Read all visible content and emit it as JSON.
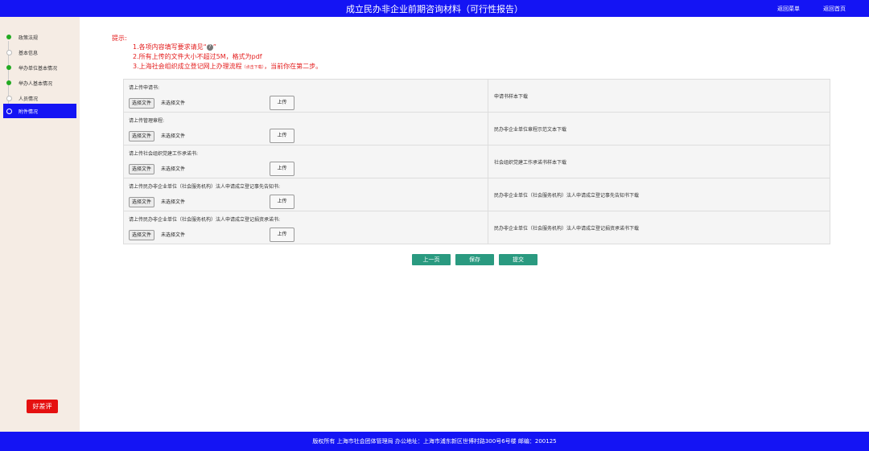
{
  "header": {
    "title": "成立民办非企业前期咨询材料（可行性报告）",
    "return_menu": "返回菜单",
    "return_home": "返回首页"
  },
  "sidebar": {
    "items": [
      {
        "label": "政策法规",
        "state": "done"
      },
      {
        "label": "基本信息",
        "state": "todo"
      },
      {
        "label": "举办单位基本情况",
        "state": "done"
      },
      {
        "label": "举办人基本情况",
        "state": "done"
      },
      {
        "label": "人员情况",
        "state": "todo"
      },
      {
        "label": "附件情况",
        "state": "current"
      }
    ],
    "review_button": "好差评"
  },
  "tips": {
    "heading": "提示:",
    "line1": "1.各项内容填写要求请见“",
    "line1_end": "”",
    "help_icon": "?",
    "line2": "2.所有上传的文件大小不超过5M，格式为pdf",
    "line3_a": "3.上海社会组织成立登记网上办理流程",
    "line3_small": "（点击下载）",
    "line3_b": "，当前你在第二步。"
  },
  "uploads": [
    {
      "label": "请上传申请书:",
      "choose": "选择文件",
      "nofile": "未选择文件",
      "upload": "上传",
      "download": "申请书样本下载"
    },
    {
      "label": "请上传管理章程:",
      "choose": "选择文件",
      "nofile": "未选择文件",
      "upload": "上传",
      "download": "民办非企业单位章程示范文本下载"
    },
    {
      "label": "请上传社会组织党建工作承诺书:",
      "choose": "选择文件",
      "nofile": "未选择文件",
      "upload": "上传",
      "download": "社会组织党建工作承诺书样本下载"
    },
    {
      "label": "请上传民办非企业单位（社会服务机构）法人申请成立登记事先告知书:",
      "choose": "选择文件",
      "nofile": "未选择文件",
      "upload": "上传",
      "download": "民办非企业单位（社会服务机构）法人申请成立登记事先告知书下载"
    },
    {
      "label": "请上传民办非企业单位（社会服务机构）法人申请成立登记捐资承诺书:",
      "choose": "选择文件",
      "nofile": "未选择文件",
      "upload": "上传",
      "download": "民办非企业单位（社会服务机构）法人申请成立登记捐资承诺书下载"
    }
  ],
  "actions": {
    "prev": "上一页",
    "save": "保存",
    "submit": "提交"
  },
  "footer": {
    "text": "版权所有 上海市社会团体管理局 办公地址：上海市浦东新区世博村路300号6号楼 邮编：200125"
  },
  "colors": {
    "brand_blue": "#1414f4",
    "tip_red": "#e31b1b",
    "action_green": "#2a9a80",
    "review_red": "#e51010",
    "sidebar_bg": "#f5ece4"
  }
}
